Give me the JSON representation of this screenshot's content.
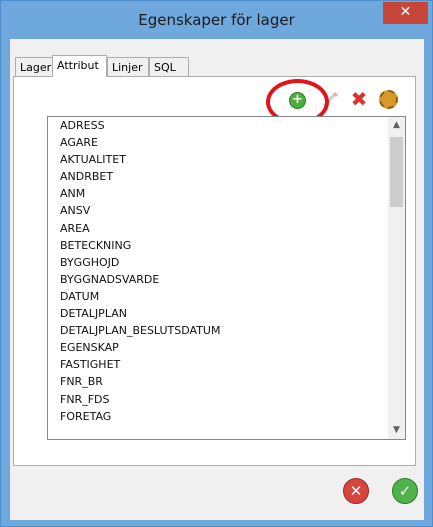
{
  "window": {
    "title": "Egenskaper för lager",
    "close_glyph": "✕"
  },
  "tabs": [
    {
      "label": "Lager",
      "active": false
    },
    {
      "label": "Attribut",
      "active": true
    },
    {
      "label": "Linjer",
      "active": false
    },
    {
      "label": "SQL",
      "active": false
    }
  ],
  "toolbar": {
    "add_icon": "add-icon",
    "add_glyph": "+",
    "edit_icon": "pencil-icon",
    "delete_icon": "delete-icon",
    "delete_glyph": "✖",
    "settings_icon": "gear-icon"
  },
  "attributes": [
    "ADRESS",
    "AGARE",
    "AKTUALITET",
    "ANDRBET",
    "ANM",
    "ANSV",
    "AREA",
    "BETECKNING",
    "BYGGHOJD",
    "BYGGNADSVARDE",
    "DATUM",
    "DETALJPLAN",
    "DETALJPLAN_BESLUTSDATUM",
    "EGENSKAP",
    "FASTIGHET",
    "FNR_BR",
    "FNR_FDS",
    "FORETAG"
  ],
  "scrollbar": {
    "up_glyph": "▲",
    "down_glyph": "▼"
  },
  "footer": {
    "cancel_icon": "cancel-icon",
    "cancel_glyph": "✕",
    "ok_icon": "ok-icon",
    "ok_glyph": "✓"
  },
  "colors": {
    "title_bar": "#6fa8dc",
    "close_button": "#c7463a",
    "highlight": "#e0141a",
    "add": "#4caf3d",
    "cancel": "#d6463e",
    "ok": "#4fb24a"
  }
}
